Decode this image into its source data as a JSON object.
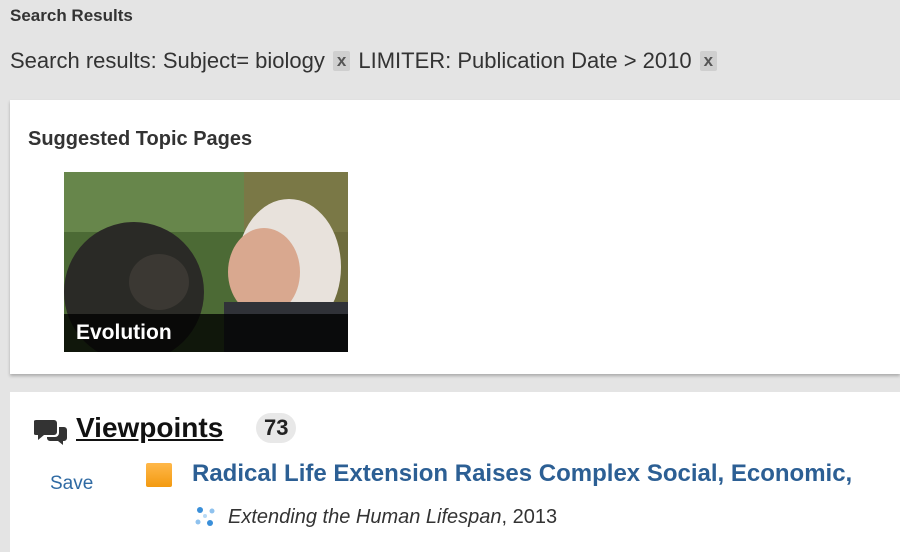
{
  "header": {
    "title": "Search Results"
  },
  "query": {
    "prefix": "Search results: Subject= biology",
    "remove_label": "x",
    "limiter": "LIMITER: Publication Date > 2010"
  },
  "topics": {
    "heading": "Suggested Topic Pages",
    "cards": [
      {
        "label": "Evolution"
      }
    ]
  },
  "results": {
    "section_title": "Viewpoints",
    "count": "73",
    "items": [
      {
        "save_label": "Save",
        "title": "Radical Life Extension Raises Complex Social, Economic,",
        "publication": "Extending the Human Lifespan",
        "year": ", 2013"
      }
    ]
  },
  "colors": {
    "link": "#2c5f94",
    "save": "#2f6aa3",
    "badge": "#f39a10",
    "panel": "#ffffff",
    "page": "#e4e4e4"
  }
}
